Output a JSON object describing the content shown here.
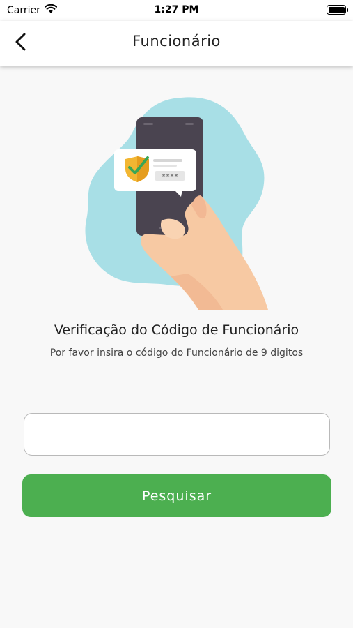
{
  "status_bar": {
    "carrier": "Carrier",
    "time": "1:27 PM",
    "wifi_icon": "wifi-icon",
    "battery_icon": "battery-icon"
  },
  "nav": {
    "title": "Funcionário",
    "back_icon": "chevron-left-icon"
  },
  "illustration": {
    "description_icon": "phone-verification-illustration",
    "password_mask": "****"
  },
  "content": {
    "heading": "Verificação do Código de Funcionário",
    "subheading": "Por favor insira o código do Funcionário de 9 digitos"
  },
  "form": {
    "code_value": "",
    "code_placeholder": "",
    "search_label": "Pesquisar"
  },
  "colors": {
    "primary_green": "#4caf50",
    "blob_blue": "#a8dfe6",
    "phone_dark": "#4a4450",
    "shield_gold": "#f2b632",
    "check_green": "#3aa655",
    "skin": "#f7c9a3"
  }
}
